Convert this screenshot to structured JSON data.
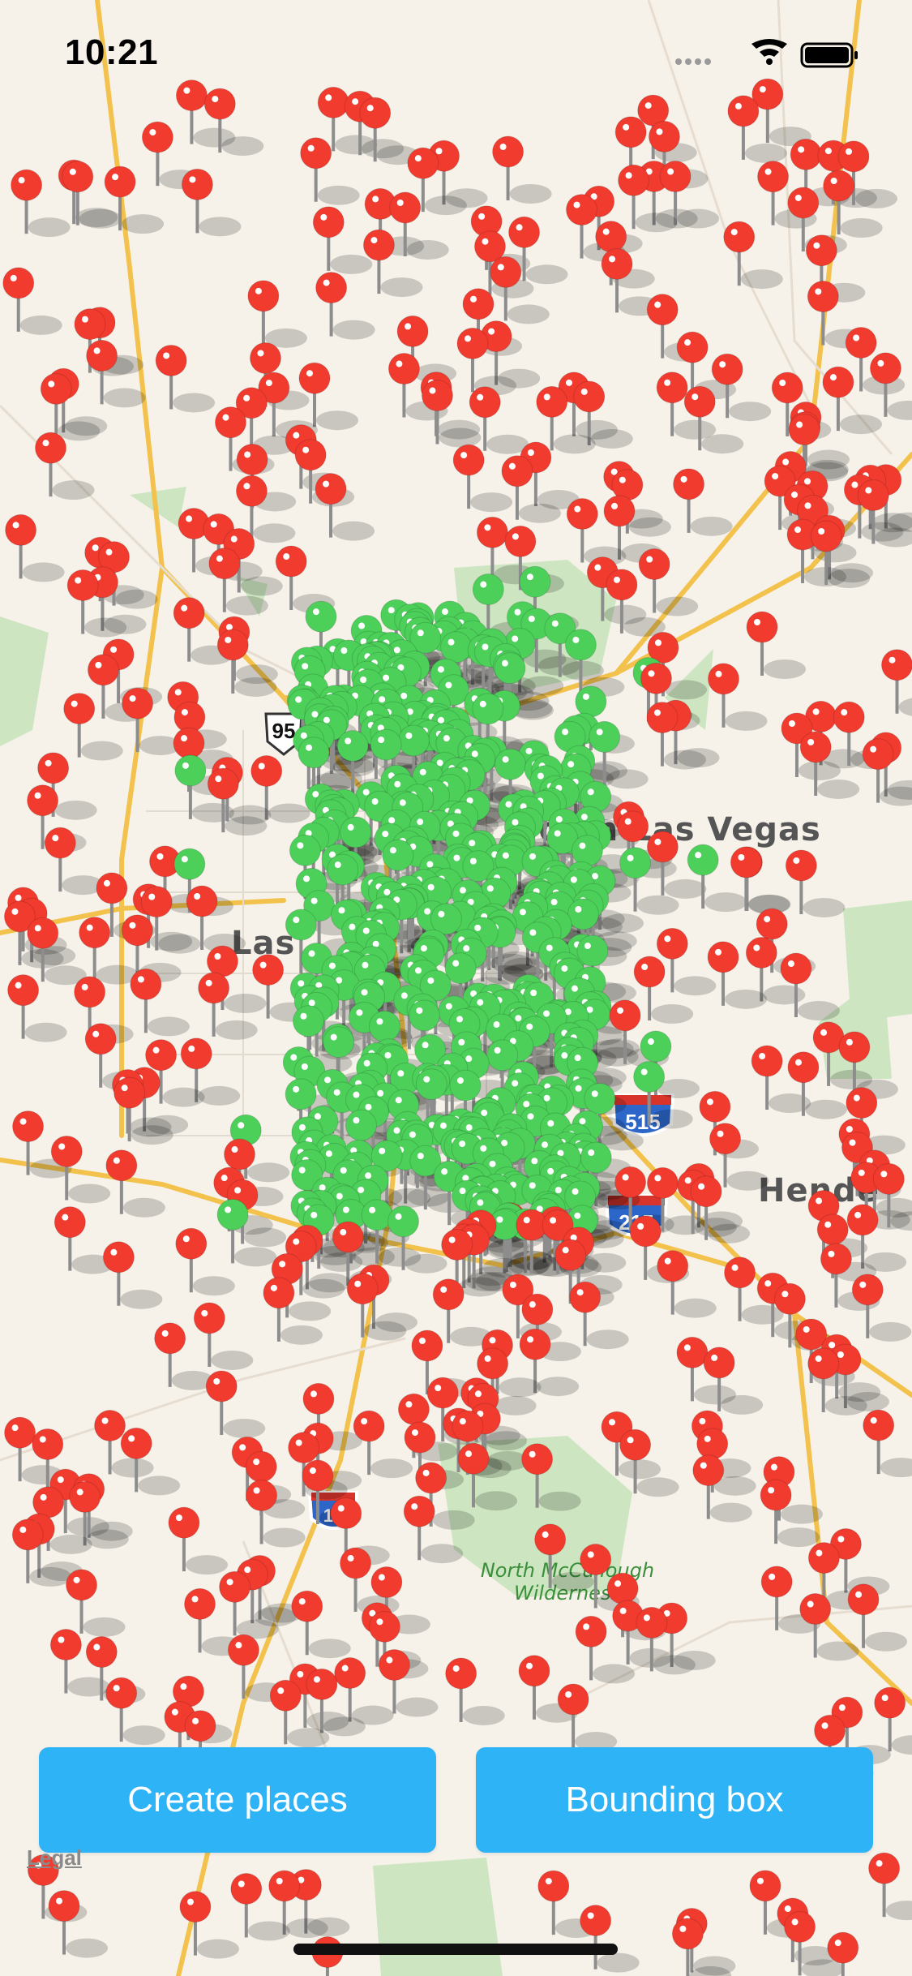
{
  "status_bar": {
    "time": "10:21",
    "icons": [
      "signal-dots-icon",
      "wifi-icon",
      "battery-icon"
    ]
  },
  "map": {
    "labels": {
      "north_las_vegas": "North Las Vegas",
      "las_vegas": "Las",
      "henderson": "Hende",
      "north_mccullough_1": "North McCullough",
      "north_mccullough_2": "Wilderness"
    },
    "shields": {
      "us95": "95",
      "i515": "515",
      "i215": "215",
      "i15": "15"
    },
    "legal": "Legal",
    "pin_colors": {
      "outside": "#f23b2f",
      "inside": "#4cd05a"
    }
  },
  "buttons": {
    "create_places": "Create places",
    "bounding_box": "Bounding box"
  }
}
